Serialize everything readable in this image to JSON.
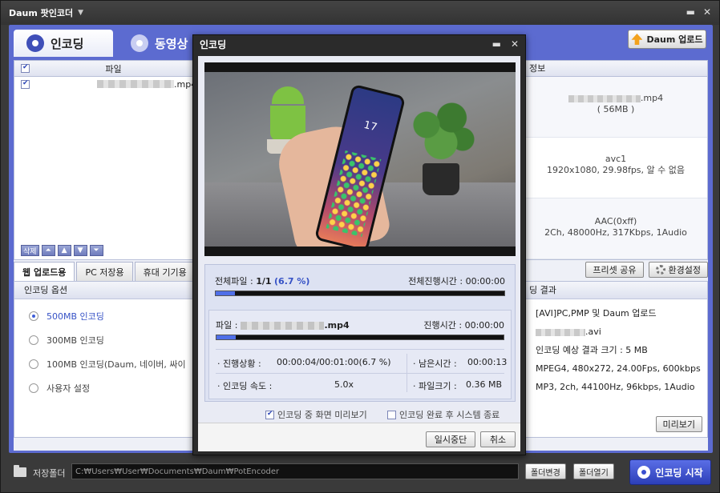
{
  "app": {
    "title": "Daum 팟인코더"
  },
  "tabs": {
    "encode": "인코딩",
    "edit": "동영상 편"
  },
  "header": {
    "daum_upload": "Daum 업로드"
  },
  "file_list": {
    "column": "파일",
    "rows": [
      {
        "ext": ".mp4"
      }
    ]
  },
  "list_tools": {
    "delete": "삭제"
  },
  "info": {
    "header": "정보",
    "file_ext": ".mp4",
    "file_size": "( 56MB )",
    "video_codec": "avc1",
    "video_detail": "1920x1080, 29.98fps, 알 수 없음",
    "audio_codec": "AAC(0xff)",
    "audio_detail": "2Ch, 48000Hz, 317Kbps, 1Audio"
  },
  "sub_tabs": [
    "웹 업로드용",
    "PC 저장용",
    "휴대 기기용"
  ],
  "preset": {
    "share": "프리셋 공유",
    "settings": "환경설정"
  },
  "options": {
    "header": "인코딩 옵션",
    "items": [
      "500MB 인코딩",
      "300MB 인코딩",
      "100MB 인코딩(Daum, 네이버, 싸이",
      "사용자 설정"
    ]
  },
  "result": {
    "header": "딩 결과",
    "line1": "[AVI]PC,PMP 및 Daum 업로드",
    "line2_ext": ".avi",
    "line3": "인코딩 예상 결과 크기 : 5 MB",
    "line4": "MPEG4, 480x272, 24.00Fps, 600kbps",
    "line5": "MP3, 2ch, 44100Hz, 96kbps, 1Audio",
    "preview": "미리보기"
  },
  "bottom": {
    "save_label": "저장폴더",
    "path": "C:₩Users₩User₩Documents₩Daum₩PotEncoder",
    "change_folder": "폴더변경",
    "open_folder": "폴더열기",
    "start": "인코딩 시작"
  },
  "dialog": {
    "title": "인코딩",
    "total_label": "전체파일 :",
    "total_count": "1/1",
    "total_pct": "(6.7 %)",
    "total_time_label": "전체진행시간 :",
    "total_time": "00:00:00",
    "total_progress": 0.067,
    "file_label": "파일 :",
    "file_ext": ".mp4",
    "file_time_label": "진행시간 :",
    "file_time": "00:00:00",
    "file_progress": 0.067,
    "status_label": "· 진행상황 :",
    "status_value": "00:00:04/00:01:00(6.7 %)",
    "remain_label": "· 남은시간 :",
    "remain_value": "00:00:13",
    "speed_label": "· 인코딩 속도 :",
    "speed_value": "5.0x",
    "size_label": "· 파일크기 :",
    "size_value": "0.36 MB",
    "video_clock": "17",
    "chk_preview": "인코딩 중 화면 미리보기",
    "chk_shutdown": "인코딩 완료 후 시스템 종료",
    "pause": "일시중단",
    "cancel": "취소"
  }
}
